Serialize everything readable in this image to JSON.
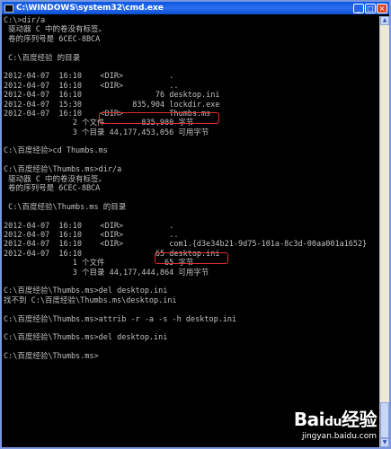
{
  "window": {
    "title": "C:\\WINDOWS\\system32\\cmd.exe",
    "buttons": {
      "minimize": "_",
      "maximize": "□",
      "close": "×"
    }
  },
  "console_lines": [
    "C:\\>dir/a",
    " 驱动器 C 中的卷没有标签。",
    " 卷的序列号是 6CEC-8BCA",
    "",
    " C:\\百度经验 的目录",
    "",
    "2012-04-07  16:10    <DIR>          .",
    "2012-04-07  16:10    <DIR>          ..",
    "2012-04-07  16:10                76 desktop.ini",
    "2012-04-07  15:30           835,904 lockdir.exe",
    "2012-04-07  16:10    <DIR>          Thumbs.ms",
    "               2 个文件        835,980 字节",
    "               3 个目录 44,177,453,056 可用字节",
    "",
    "C:\\百度经验>cd Thumbs.ms",
    "",
    "C:\\百度经验\\Thumbs.ms>dir/a",
    " 驱动器 C 中的卷没有标签。",
    " 卷的序列号是 6CEC-8BCA",
    "",
    " C:\\百度经验\\Thumbs.ms 的目录",
    "",
    "2012-04-07  16:10    <DIR>          .",
    "2012-04-07  16:10    <DIR>          ..",
    "2012-04-07  16:10    <DIR>          com1.{d3e34b21-9d75-101a-8c3d-00aa001a1652}",
    "2012-04-07  16:10                65 desktop.ini",
    "               1 个文件             65 字节",
    "               3 个目录 44,177,444,864 可用字节",
    "",
    "C:\\百度经验\\Thumbs.ms>del desktop.ini",
    "找不到 C:\\百度经验\\Thumbs.ms\\desktop.ini",
    "",
    "C:\\百度经验\\Thumbs.ms>attrib -r -a -s -h desktop.ini",
    "",
    "C:\\百度经验\\Thumbs.ms>del desktop.ini",
    "",
    "C:\\百度经验\\Thumbs.ms>"
  ],
  "watermark": {
    "brand": "Bai",
    "paw": "du",
    "suffix": "经验",
    "url": "jingyan.baidu.com"
  },
  "colors": {
    "console_bg": "#000000",
    "console_text": "#c0c0c0",
    "highlight": "#e03030",
    "titlebar": "#0a58e0"
  }
}
